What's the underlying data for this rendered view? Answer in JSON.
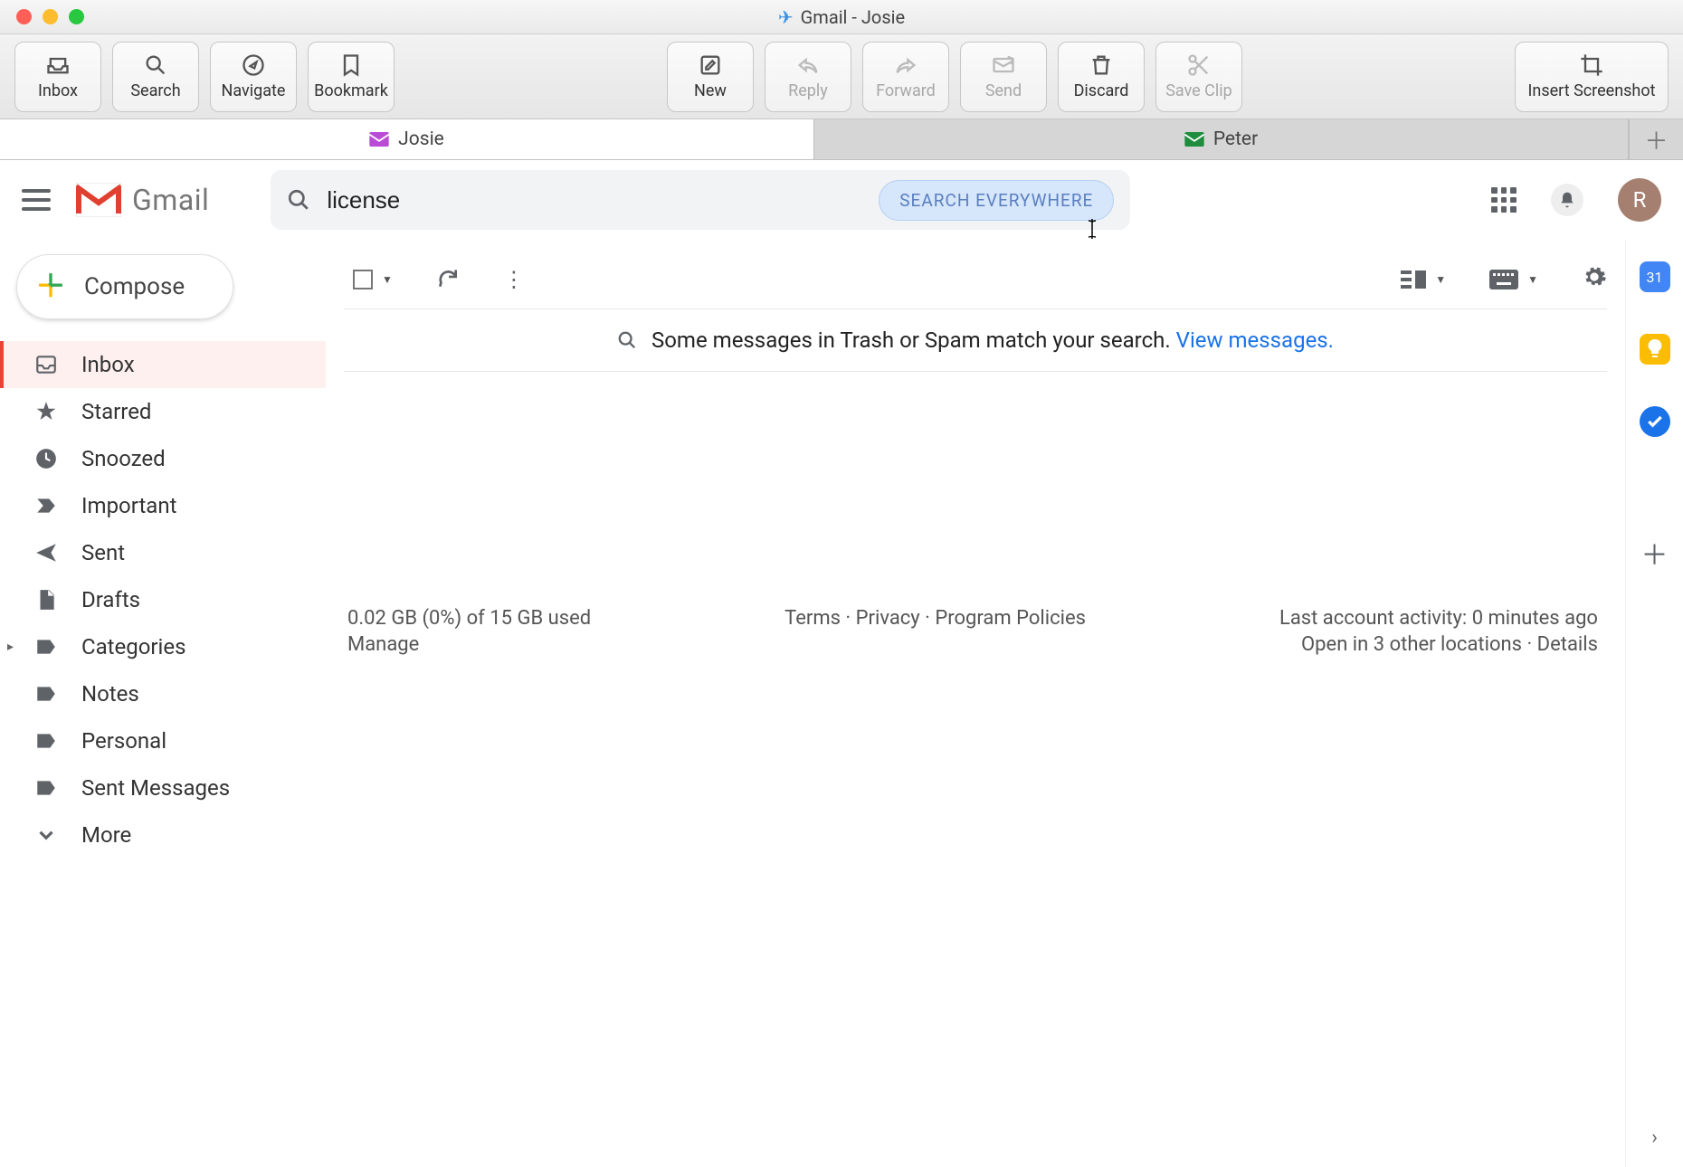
{
  "window": {
    "title": "Gmail - Josie",
    "plane_glyph": "✈"
  },
  "app_toolbar": {
    "inbox": "Inbox",
    "search": "Search",
    "navigate": "Navigate",
    "bookmark": "Bookmark",
    "new": "New",
    "reply": "Reply",
    "forward": "Forward",
    "send": "Send",
    "discard": "Discard",
    "save_clip": "Save Clip",
    "insert_screenshot": "Insert Screenshot"
  },
  "account_tabs": {
    "active": "Josie",
    "inactive": "Peter",
    "active_color": "#b94bd6",
    "inactive_color": "#1e8e3e"
  },
  "gmail": {
    "brand_word": "Gmail",
    "search_value": "license",
    "search_pill": "SEARCH EVERYWHERE",
    "avatar_letter": "R",
    "avatar_bg": "#a58070"
  },
  "compose_label": "Compose",
  "sidebar_items": [
    {
      "label": "Inbox",
      "icon": "inbox",
      "active": true
    },
    {
      "label": "Starred",
      "icon": "star"
    },
    {
      "label": "Snoozed",
      "icon": "clock"
    },
    {
      "label": "Important",
      "icon": "important"
    },
    {
      "label": "Sent",
      "icon": "send"
    },
    {
      "label": "Drafts",
      "icon": "draft"
    },
    {
      "label": "Categories",
      "icon": "label",
      "expandable": true
    },
    {
      "label": "Notes",
      "icon": "label"
    },
    {
      "label": "Personal",
      "icon": "label"
    },
    {
      "label": "Sent Messages",
      "icon": "label"
    },
    {
      "label": "More",
      "icon": "expand"
    }
  ],
  "banner": {
    "text": "Some messages in Trash or Spam match your search. ",
    "link": "View messages."
  },
  "footer": {
    "storage_line": "0.02 GB (0%) of 15 GB used",
    "manage": "Manage",
    "links_line": "Terms · Privacy · Program Policies",
    "activity_line": "Last account activity: 0 minutes ago",
    "locations_line": "Open in 3 other locations · Details"
  },
  "rail": {
    "calendar_day": "31"
  }
}
